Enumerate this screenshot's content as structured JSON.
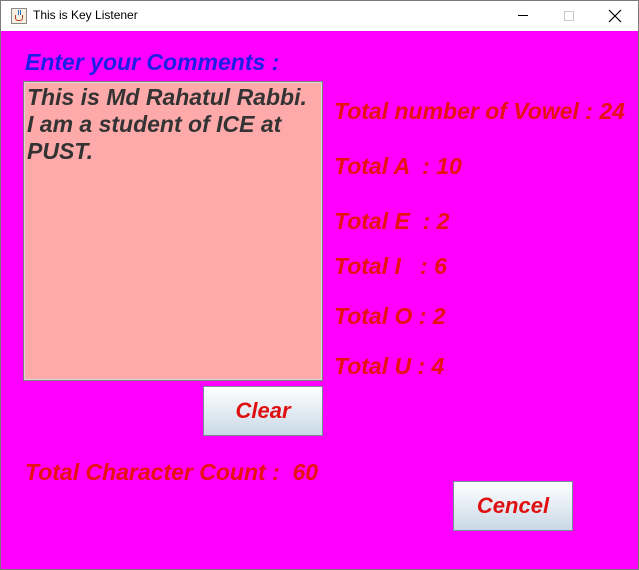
{
  "window": {
    "title": "This is Key Listener",
    "app_icon": "java-cup-icon",
    "controls": [
      "minimize-icon",
      "maximize-icon",
      "close-icon"
    ]
  },
  "colors": {
    "background": "#ff00ff",
    "heading": "#1e1ee6",
    "stat_text": "#e81010",
    "textarea_bg": "#ffaaaa",
    "textarea_text": "#333333"
  },
  "comments": {
    "label": "Enter your Comments :",
    "value": "This is Md Rahatul Rabbi.\nI am a student of ICE at\nPUST."
  },
  "stats": {
    "total_vowel": "Total number of Vowel : 24",
    "total_a": "Total A  : 10",
    "total_e": "Total E  : 2",
    "total_i": "Total I   : 6",
    "total_o": "Total O : 2",
    "total_u": "Total U : 4",
    "char_count": "Total Character Count :  60"
  },
  "buttons": {
    "clear": "Clear",
    "cancel": "Cencel"
  }
}
